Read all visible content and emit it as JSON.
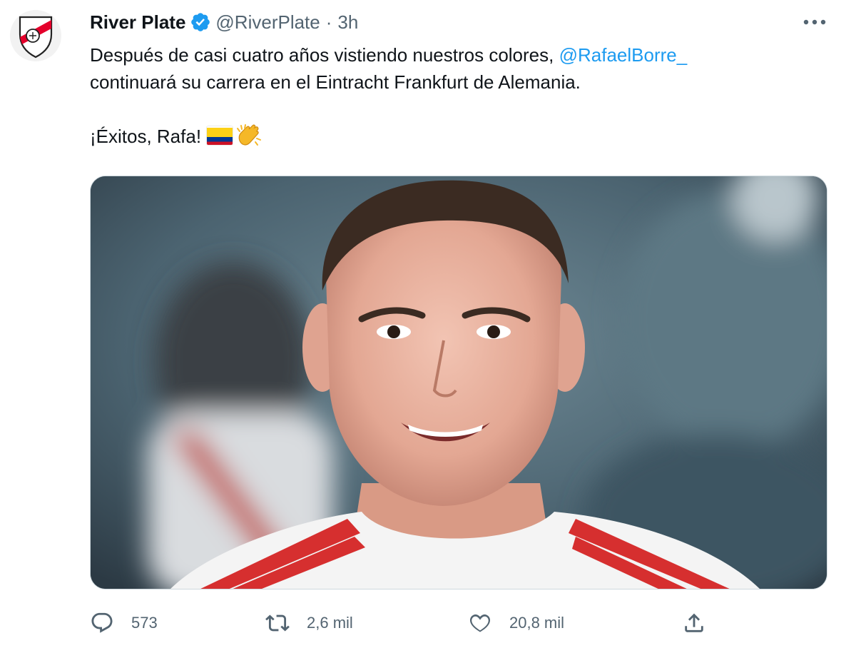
{
  "author": {
    "display_name": "River Plate",
    "handle": "@RiverPlate",
    "separator": "·",
    "time": "3h"
  },
  "tweet": {
    "line1_text": "Después de casi cuatro años vistiendo nuestros colores, ",
    "mention": "@RafaelBorre_",
    "line2_text": "continuará su carrera en el Eintracht Frankfurt de Alemania.",
    "line3_text": "¡Éxitos, Rafa!"
  },
  "icons": {
    "avatar": "river-plate-crest",
    "verified": "verified-badge-icon",
    "more": "more-dots-icon",
    "flag": "colombia-flag-emoji",
    "clap": "clapping-hands-emoji",
    "reply": "reply-icon",
    "retweet": "retweet-icon",
    "like": "heart-icon",
    "share": "share-icon"
  },
  "actions": {
    "replies": "573",
    "retweets": "2,6 mil",
    "likes": "20,8 mil"
  },
  "colors": {
    "accent": "#1d9bf0",
    "text": "#0f1419",
    "muted": "#536471",
    "river_red": "#e4002b"
  }
}
